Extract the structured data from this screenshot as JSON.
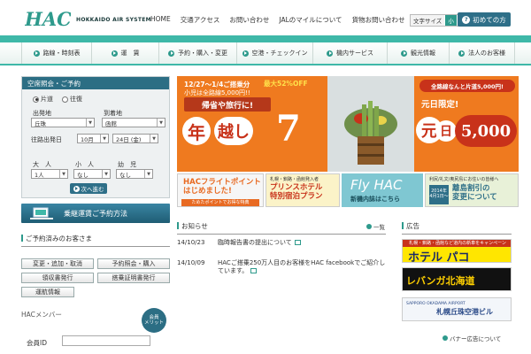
{
  "header": {
    "logo_text": "HAC",
    "logo_sub": "HOKKAIDO AIR SYSTEM",
    "nav": [
      "HOME",
      "交通アクセス",
      "お問い合わせ",
      "JALのマイルについて",
      "貨物お問い合わせ"
    ],
    "font_size_label": "文字サイズ",
    "font_small": "小",
    "font_large": "大",
    "first_time_label": "初めての方"
  },
  "main_nav": [
    "路線・時刻表",
    "運　賃",
    "予約・購入・変更",
    "空港・チェックイン",
    "機内サービス",
    "観光情報",
    "法人のお客様"
  ],
  "search": {
    "title": "空席照会・ご予約",
    "oneway": "片道",
    "roundtrip": "往復",
    "origin_label": "出発地",
    "origin_value": "丘珠",
    "dest_label": "到着地",
    "dest_value": "函館",
    "date_label": "往路出発日",
    "month_value": "10月",
    "day_value": "24日 (金)",
    "adult_label": "大　人",
    "adult_value": "1人",
    "child_label": "小　人",
    "child_value": "なし",
    "infant_label": "幼　児",
    "infant_value": "なし",
    "next_label": "次へ進む"
  },
  "transfer_banner": "乗継運賃ご予約方法",
  "reserved": {
    "title": "ご予約済みのお客さま",
    "buttons": [
      "変更・追加・取消",
      "予約照会・購入",
      "領収書発行",
      "搭乗証明書発行",
      "運航情報"
    ]
  },
  "member": {
    "title": "HACメンバー",
    "badge_line1": "会員",
    "badge_line2": "メリット",
    "id_label": "会員ID"
  },
  "hero": {
    "dates": "12/27～1/4ご搭乗分",
    "sale": "最大52%OFF",
    "child_note": "小児は全路線5,000円!!",
    "ribbon": "帰省や旅行に!",
    "char_nen": "年",
    "char_koshi": "越し",
    "big_number": "7",
    "right_top": "全路線なんと片道5,000円!",
    "right_mid": "元日限定!",
    "char_gan": "元",
    "char_nichi": "日",
    "big_price": "5,000"
  },
  "promos": {
    "p1_line1": "HACフライトポイント",
    "p1_line2": "はじめました!",
    "p1_note": "ためたポイントでお得な特典",
    "p2_note": "札幌・釧路・函館発入者",
    "p2_line1": "プリンスホテル",
    "p2_line2": "特別宿泊プラン",
    "p3_line1": "Fly HAC",
    "p3_line2": "新機内誌はこちら",
    "p4_note": "利尻/礼文/奥尻島にお住いの皆様へ",
    "p4_date": "2014年 4月1日～",
    "p4_line1": "離島割引の",
    "p4_line2": "変更について"
  },
  "news": {
    "title": "お知らせ",
    "all_label": "一覧",
    "items": [
      {
        "date": "14/10/23",
        "text": "臨時報告書の提出について"
      },
      {
        "date": "14/10/09",
        "text": "HACご搭乗250万人目のお客様をHAC facebookでご紹介しています。"
      }
    ]
  },
  "ads": {
    "title": "広告",
    "ad1_caption": "札幌・釧路・函館など道内の新車をキャンペーン",
    "ad1_text": "ホテル パコ",
    "ad2_text": "レバンガ北海道",
    "ad3_sub": "SAPPORO OKADAMA AIRPORT",
    "ad3_text": "札幌丘珠空港ビル",
    "banner_link": "バナー広告について"
  }
}
